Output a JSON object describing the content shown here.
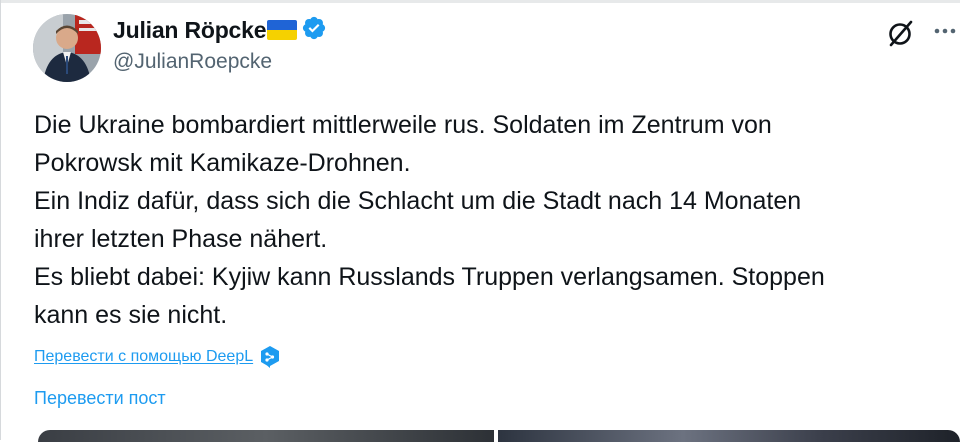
{
  "author": {
    "display_name": "Julian Röpcke",
    "handle": "@JulianRoepcke",
    "flag": "ukraine-flag",
    "verified": true
  },
  "tweet": {
    "lines": [
      "Die Ukraine bombardiert mittlerweile rus. Soldaten im Zentrum von",
      "Pokrowsk mit Kamikaze-Drohnen.",
      "Ein Indiz dafür, dass sich die Schlacht um die Stadt nach 14 Monaten",
      "ihrer letzten Phase nähert.",
      "Es bliebt dabei: Kyjiw kann Russlands Truppen verlangsamen. Stoppen",
      "kann es sie nicht."
    ]
  },
  "actions": {
    "translate_deepl_label": "Перевести с помощью DeepL",
    "translate_post_label": "Перевести пост"
  },
  "icons": {
    "grok": "grok-icon",
    "more": "more-options-icon",
    "verified": "verified-badge-icon",
    "deepl": "deepl-icon"
  },
  "colors": {
    "accent": "#1d9bf0",
    "text": "#0f1419",
    "secondary": "#536471",
    "flag_blue": "#1f64d6",
    "flag_yellow": "#f5d100"
  }
}
